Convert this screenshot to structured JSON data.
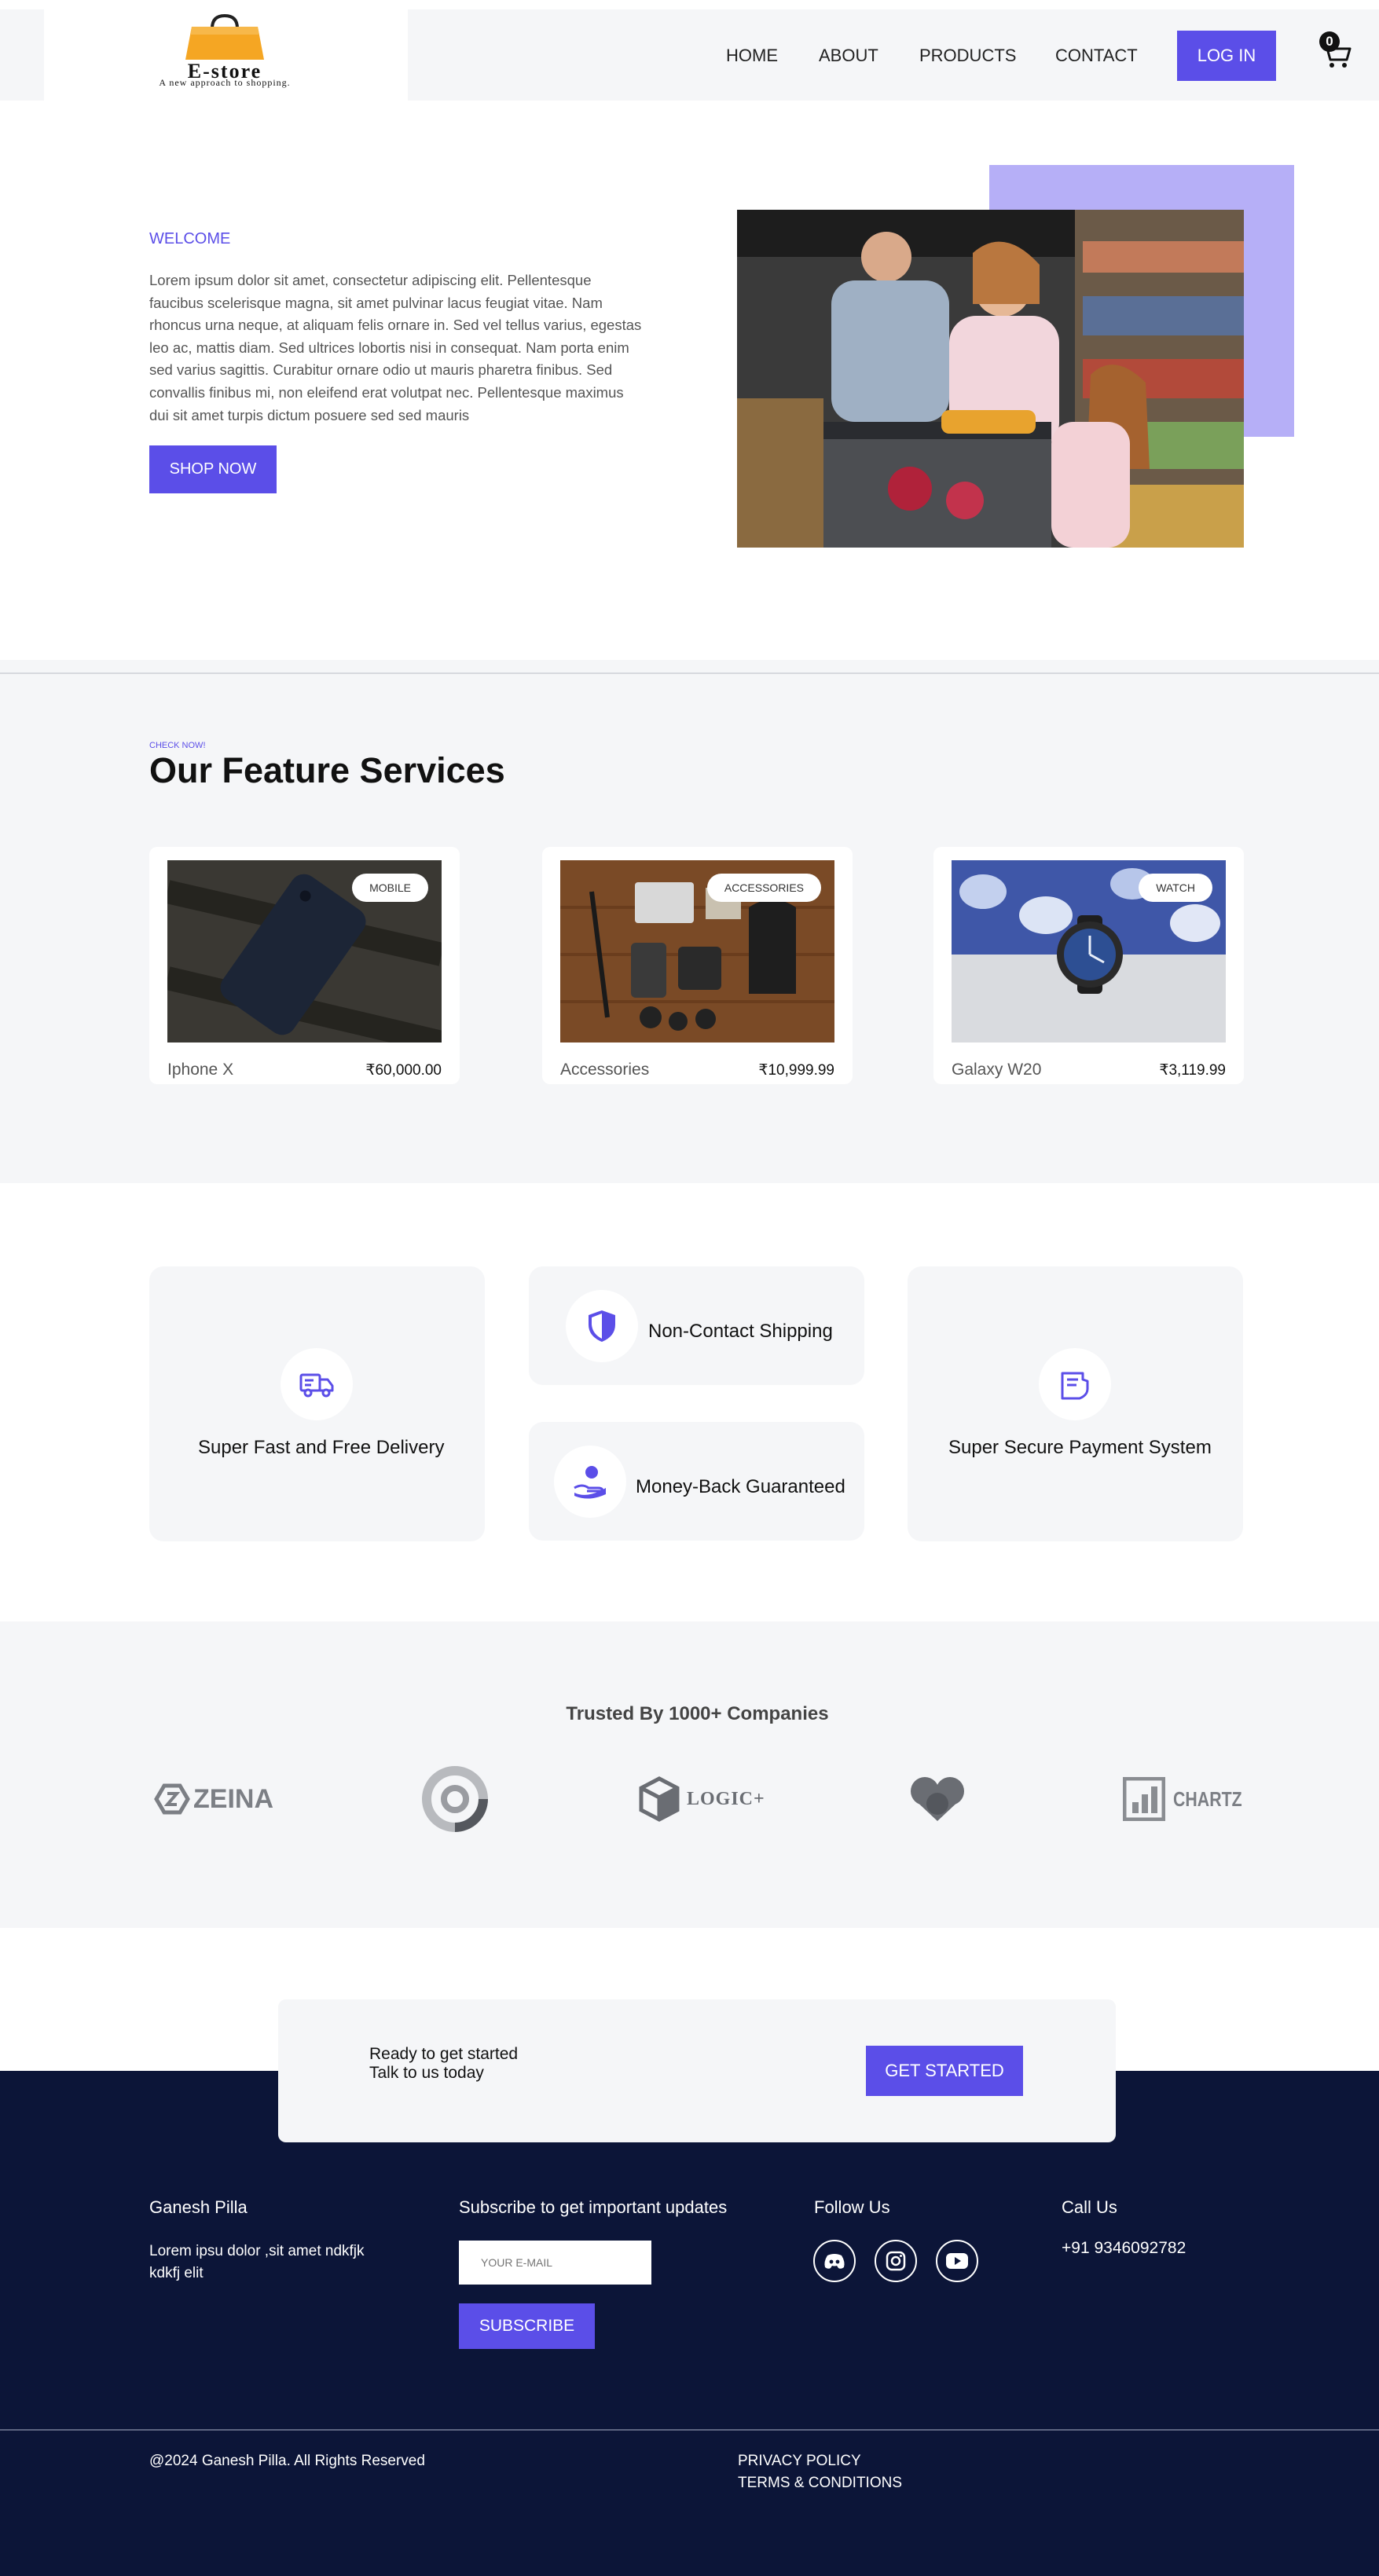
{
  "header": {
    "logo_text": "E-store",
    "logo_tagline": "A new approach to shopping.",
    "nav": [
      "HOME",
      "ABOUT",
      "PRODUCTS",
      "CONTACT"
    ],
    "login_label": "LOG IN",
    "cart_count": "0"
  },
  "hero": {
    "eyebrow": "WELCOME",
    "text": "Lorem ipsum dolor sit amet, consectetur adipiscing elit. Pellentesque faucibus scelerisque magna, sit amet pulvinar lacus feugiat vitae. Nam rhoncus urna neque, at aliquam felis ornare in. Sed vel tellus varius, egestas leo ac, mattis diam. Sed ultrices lobortis nisi in consequat. Nam porta enim sed varius sagittis. Curabitur ornare odio ut mauris pharetra finibus. Sed convallis finibus mi, non eleifend erat volutpat nec. Pellentesque maximus dui sit amet turpis dictum posuere sed sed mauris",
    "button": "SHOP NOW"
  },
  "services": {
    "eyebrow": "CHECK NOW!",
    "title": "Our Feature Services",
    "cards": [
      {
        "badge": "MOBILE",
        "name": "Iphone X",
        "price": "₹60,000.00"
      },
      {
        "badge": "ACCESSORIES",
        "name": "Accessories",
        "price": "₹10,999.99"
      },
      {
        "badge": "WATCH",
        "name": "Galaxy W20",
        "price": "₹3,119.99"
      }
    ]
  },
  "features": {
    "delivery": "Super Fast and Free Delivery",
    "shipping": "Non-Contact Shipping",
    "money_back": "Money-Back Guaranteed",
    "payment": "Super Secure Payment System"
  },
  "trusted": {
    "title": "Trusted By 1000+ Companies",
    "brands": [
      "ZEINA",
      "LOGIC+",
      "CHARTZ"
    ]
  },
  "cta": {
    "line1": "Ready to get started",
    "line2": "Talk to us today",
    "button": "GET STARTED"
  },
  "footer": {
    "name": "Ganesh Pilla",
    "about": "Lorem ipsu dolor ,sit amet ndkfjk kdkfj elit",
    "subscribe_heading": "Subscribe to get important updates",
    "email_placeholder": "YOUR E-MAIL",
    "subscribe_button": "SUBSCRIBE",
    "follow_heading": "Follow Us",
    "call_heading": "Call Us",
    "phone": "+91 9346092782",
    "copyright": "@2024 Ganesh Pilla. All Rights Reserved",
    "privacy": "PRIVACY POLICY",
    "terms": "TERMS & CONDITIONS"
  },
  "colors": {
    "accent": "#5b4ee8",
    "accent_light": "#b6aff7",
    "footer_bg": "#0c1538",
    "section_bg": "#f5f6f8"
  },
  "icons": [
    "shopping-bag-icon",
    "cart-icon",
    "truck-icon",
    "shield-icon",
    "hand-money-icon",
    "card-shield-icon",
    "discord-icon",
    "instagram-icon",
    "youtube-icon"
  ]
}
